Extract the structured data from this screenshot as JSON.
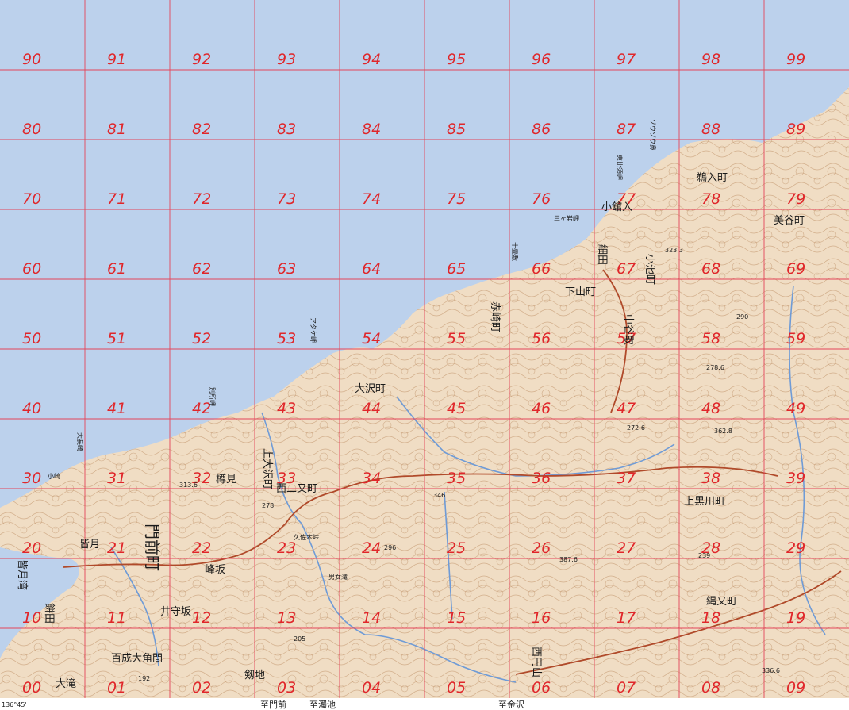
{
  "map": {
    "colors": {
      "sea": "#bcd1ec",
      "land": "#f0ddc4",
      "contour": "#b98a60",
      "grid": "#e4455a",
      "label": "#e0262a",
      "river": "#6f9bd6",
      "road": "#b04a2a"
    },
    "grid_rows": [
      [
        "90",
        "91",
        "92",
        "93",
        "94",
        "95",
        "96",
        "97",
        "98",
        "99"
      ],
      [
        "80",
        "81",
        "82",
        "83",
        "84",
        "85",
        "86",
        "87",
        "88",
        "89"
      ],
      [
        "70",
        "71",
        "72",
        "73",
        "74",
        "75",
        "76",
        "77",
        "78",
        "79"
      ],
      [
        "60",
        "61",
        "62",
        "63",
        "64",
        "65",
        "66",
        "67",
        "68",
        "69"
      ],
      [
        "50",
        "51",
        "52",
        "53",
        "54",
        "55",
        "56",
        "57",
        "58",
        "59"
      ],
      [
        "40",
        "41",
        "42",
        "43",
        "44",
        "45",
        "46",
        "47",
        "48",
        "49"
      ],
      [
        "30",
        "31",
        "32",
        "33",
        "34",
        "35",
        "36",
        "37",
        "38",
        "39"
      ],
      [
        "20",
        "21",
        "22",
        "23",
        "24",
        "25",
        "26",
        "27",
        "28",
        "29"
      ],
      [
        "10",
        "11",
        "12",
        "13",
        "14",
        "15",
        "16",
        "17",
        "18",
        "19"
      ],
      [
        "00",
        "01",
        "02",
        "03",
        "04",
        "05",
        "06",
        "07",
        "08",
        "09"
      ]
    ],
    "places": [
      {
        "name": "大沢町",
        "size": "large"
      },
      {
        "name": "上大沢町",
        "size": "large"
      },
      {
        "name": "西二又町",
        "size": "large"
      },
      {
        "name": "赤崎町",
        "size": "large"
      },
      {
        "name": "下山町",
        "size": "large"
      },
      {
        "name": "中谷取",
        "size": "large"
      },
      {
        "name": "小池町",
        "size": "large"
      },
      {
        "name": "細田",
        "size": "large"
      },
      {
        "name": "小舘入",
        "size": "large"
      },
      {
        "name": "鵜入町",
        "size": "large"
      },
      {
        "name": "美谷町",
        "size": "large"
      },
      {
        "name": "門前町",
        "size": "large"
      },
      {
        "name": "皆月",
        "size": "large"
      },
      {
        "name": "樽見",
        "size": "large"
      },
      {
        "name": "峰坂",
        "size": "large"
      },
      {
        "name": "井守坂",
        "size": "large"
      },
      {
        "name": "百成大角間",
        "size": "large"
      },
      {
        "name": "大滝",
        "size": "large"
      },
      {
        "name": "餅田",
        "size": "large"
      },
      {
        "name": "上黒川町",
        "size": "large"
      },
      {
        "name": "縄又町",
        "size": "large"
      },
      {
        "name": "西円山",
        "size": "large"
      },
      {
        "name": "剱地",
        "size": "large"
      },
      {
        "name": "皆月湾",
        "size": "small"
      },
      {
        "name": "アタケ岬",
        "size": "small"
      },
      {
        "name": "ゾウゾウ鼻",
        "size": "small"
      },
      {
        "name": "恵比須岬",
        "size": "small"
      },
      {
        "name": "三ヶ岩岬",
        "size": "small"
      },
      {
        "name": "十畳敷",
        "size": "small"
      },
      {
        "name": "大長崎",
        "size": "small"
      },
      {
        "name": "小崎",
        "size": "small"
      },
      {
        "name": "別所岬",
        "size": "small"
      },
      {
        "name": "男女滝",
        "size": "small"
      },
      {
        "name": "久佐木峠",
        "size": "small"
      }
    ],
    "spot_heights": [
      "323.3",
      "290",
      "278.6",
      "272.6",
      "362.8",
      "296",
      "387.6",
      "346",
      "313.6",
      "278",
      "205",
      "192",
      "239",
      "336.6"
    ],
    "margin": {
      "corner_coord": "136°45'",
      "destinations": [
        "至門前",
        "至濁池",
        "至金沢"
      ]
    }
  }
}
